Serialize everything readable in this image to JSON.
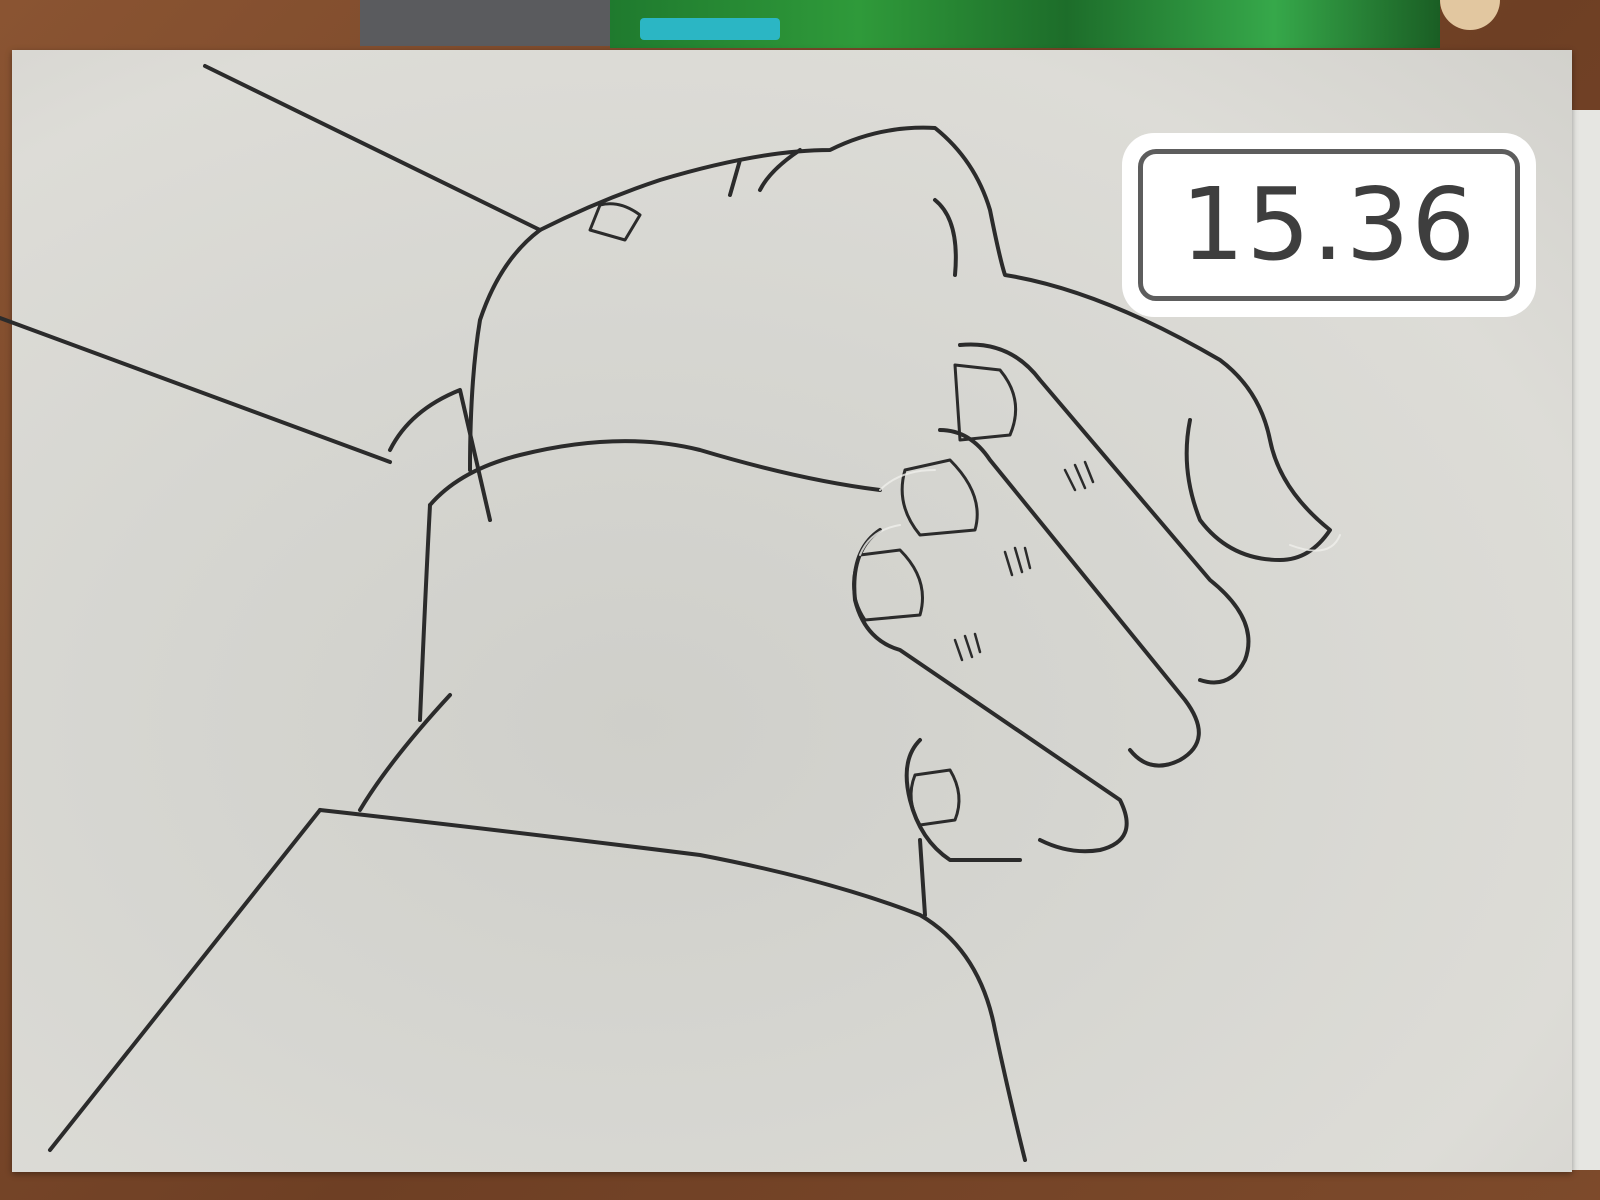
{
  "timer": {
    "value": "15.36"
  },
  "colors": {
    "paper": "#d6d6d1",
    "pencil_line": "#2b2b2b",
    "eraser_line": "#c8c8c4",
    "table": "#7a4a2c",
    "badge_border": "#5d5d5d",
    "badge_text": "#3e3e3e"
  },
  "subject": {
    "icons": [
      "pencil-sketch",
      "hands-clasped",
      "paper-sheet"
    ]
  }
}
